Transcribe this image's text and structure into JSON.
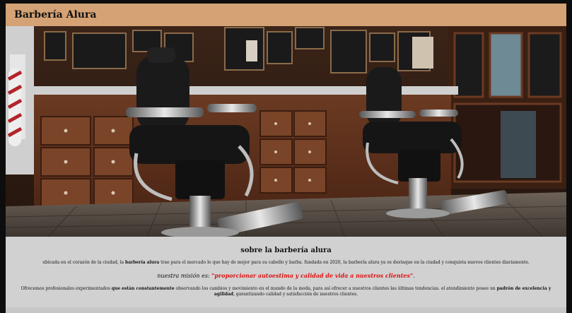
{
  "header": {
    "title": "Barbería Alura"
  },
  "banner": {
    "icon": "barbershop-interior-photo"
  },
  "about": {
    "title": "sobre la barbería alura",
    "p1_a": "ubicada en el corazón de la ciudad, la ",
    "p1_b": "barbería alura",
    "p1_c": " trae para el mercado lo que hay de mejor para su cabello y barba. fundada en 2020, la barbería alura ya es destaque en la ciudad y conquista nuevos clientes diariamente.",
    "mission_label": "nuestra misión es: ",
    "mission_quote": "\"proporcionar autoestima y calidad de vida a nuestros clientes\"",
    "mission_end": ".",
    "p2_a": "Ofrecemos profesionales experimentados ",
    "p2_b": "que están constantemente",
    "p2_c": " observando los cambios y movimiento en el mundo de la moda, para así ofrecer a nuestros clientes las últimas tendencias. el atendimiento posee un ",
    "p2_d": "padrón de excelencia y agilidad",
    "p2_e": ", garantizando calidad y satisfacción de nuestros clientes."
  },
  "colors": {
    "header_bg": "#d4a274",
    "page_bg": "#0d0d0d",
    "content_bg": "#d1d1d1",
    "mission_red": "#e01010"
  }
}
